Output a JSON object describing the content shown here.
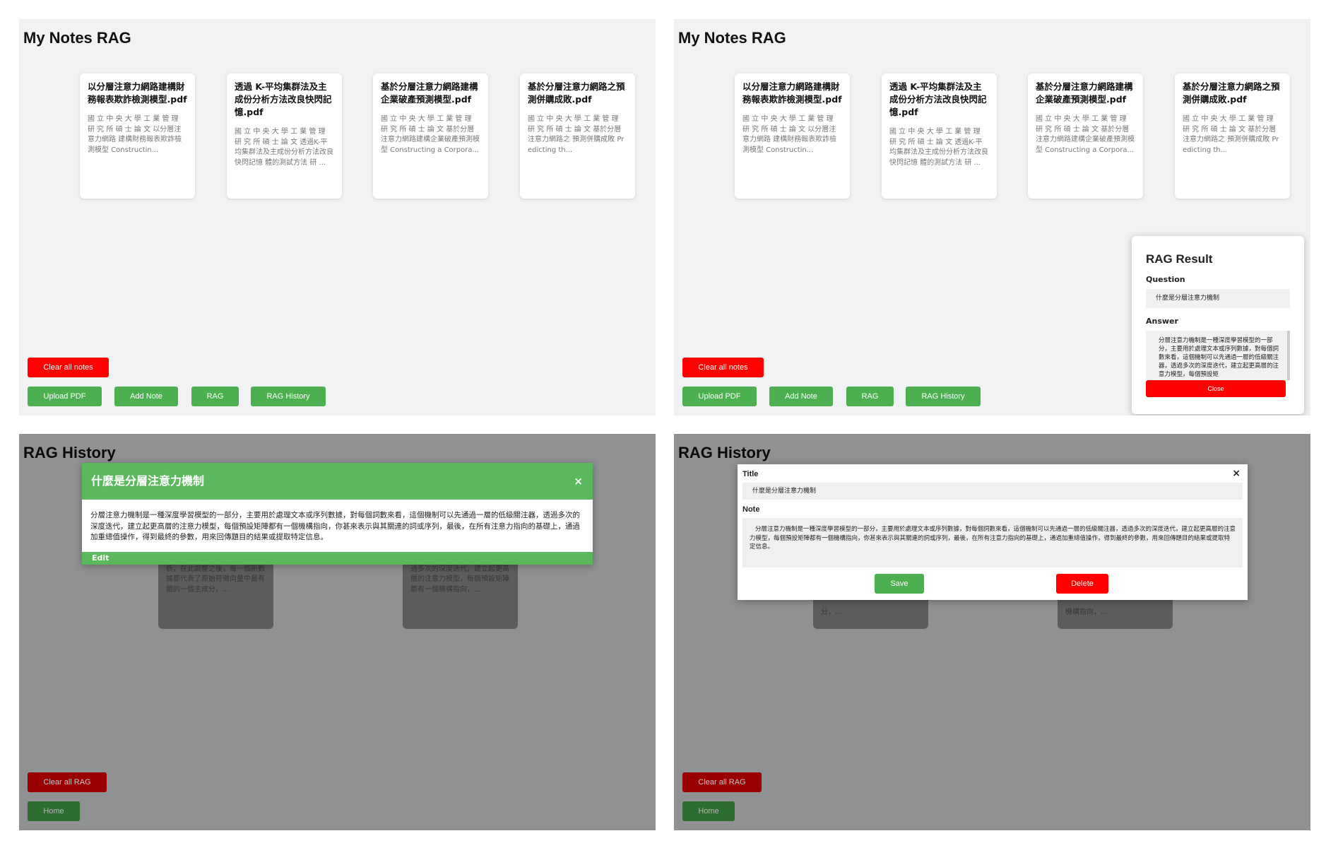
{
  "app": {
    "title": "My Notes RAG"
  },
  "notes": [
    {
      "title": "以分層注意力網路建構財務報表欺詐檢測模型.pdf",
      "snippet": "國 立 中 央 大 學 工 業 管 理 研 究 所 碩 士 論 文 以分層注意力網路 建構財務報表欺詐檢測模型 Constructin..."
    },
    {
      "title": "透過 K-平均集群法及主成份分析方法改良快閃記憶.pdf",
      "snippet": "國 立 中 央 大 學 工 業 管 理 研 究 所 碩 士 論 文 透過K-平均集群法及主成份分析方法改良快閃記憶 體的測試方法 研 ..."
    },
    {
      "title": "基於分層注意力網路建構企業破產預測模型.pdf",
      "snippet": "國 立 中 央 大 學 工 業 管 理 研 究 所 碩 士 論 文 基於分層注意力網路建構企業破產預測模型 Constructing a Corpora..."
    },
    {
      "title": "基於分層注意力網路之預測併購成敗.pdf",
      "snippet": "國 立 中 央 大 學 工 業 管 理 研 究 所 碩 士 論 文 基於分層注意力網路之 預測併購成敗 Predicting th..."
    }
  ],
  "buttons": {
    "clear_notes": "Clear all notes",
    "upload_pdf": "Upload PDF",
    "add_note": "Add Note",
    "rag": "RAG",
    "rag_history": "RAG History",
    "clear_rag": "Clear all RAG",
    "home": "Home",
    "close": "Close",
    "edit": "Edit",
    "save": "Save",
    "delete": "Delete"
  },
  "rag_result": {
    "heading": "RAG Result",
    "question_label": "Question",
    "question": "什麼是分層注意力機制",
    "answer_label": "Answer",
    "answer": "分層注意力機制是一種深度學習模型的一部分，主要用於處理文本或序列數據，對每個詞數來看，這個機制可以先通過一層的低級關注器，透過多次的深度迭代，建立起更高層的注意力模型，每個預設矩"
  },
  "history": {
    "title": "RAG History",
    "item_title": "什麼是分層注意力機制",
    "item_body": "分層注意力機制是一種深度學習模型的一部分，主要用於處理文本或序列數據，對每個詞數來看，這個機制可以先通過一層的低級關注器，透過多次的深度迭代，建立起更高層的注意力模型，每個預設矩陣都有一個機構指向，你甚來表示與其關連的詞或序列，最後，在所有注意力指向的基礎上，通過加重總值操作，得到最終的參數，用來回傳題目的結果或提取特定信息。",
    "bg_card_left": "量到新的數據來對生成分進行分析，在此調整之後，每一個新數據都代表了原始符徵向量中最有關的一個主成分，...",
    "bg_card_right": "以先通過一層的低級關注器，透過多次的深度迭代，建立起更高層的注意力模型，每個預設矩陣都有一個機構指向，...",
    "bg_card_left2": "分，...",
    "bg_card_right2": "機構指向，..."
  },
  "edit_modal": {
    "title_label": "Title",
    "note_label": "Note",
    "close_icon": "×"
  },
  "colors": {
    "red": "#ff0000",
    "green": "#4caf50",
    "modal_header": "#5cb85c"
  }
}
